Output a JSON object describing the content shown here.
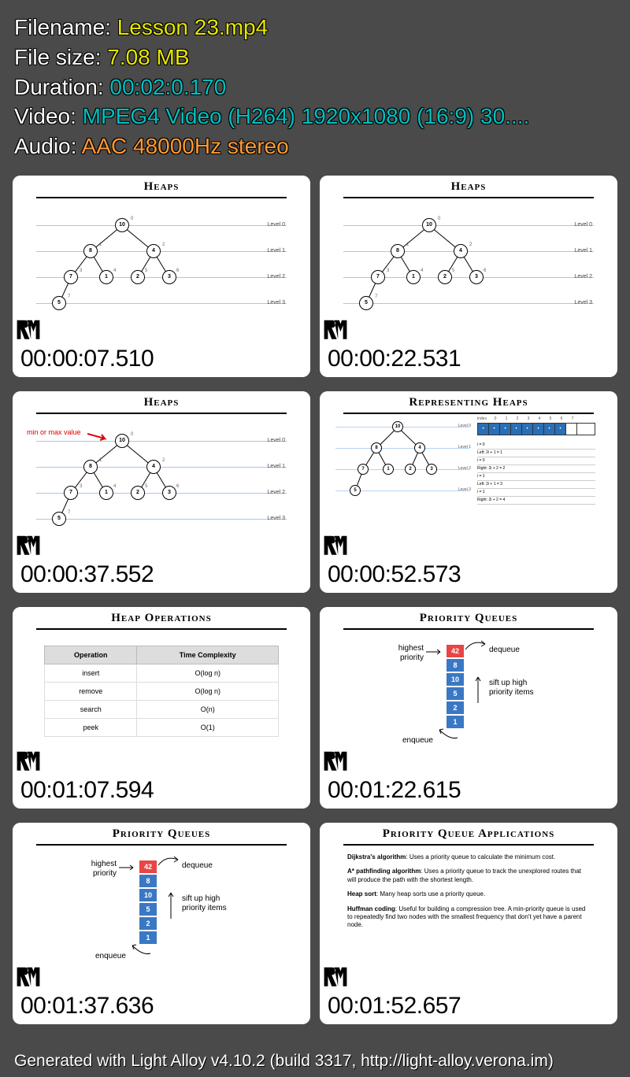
{
  "header": {
    "filename_label": "Filename: ",
    "filename_value": "Lesson 23.mp4",
    "filesize_label": "File size: ",
    "filesize_value": "7.08 MB",
    "duration_label": "Duration: ",
    "duration_value": "00:02:0.170",
    "video_label": "Video: ",
    "video_value": "MPEG4 Video (H264) 1920x1080 (16:9) 30....",
    "audio_label": "Audio: ",
    "audio_value": "AAC 48000Hz stereo"
  },
  "thumbnails": [
    {
      "ts": "00:00:07.510",
      "title": "Heaps",
      "type": "heap_tree"
    },
    {
      "ts": "00:00:22.531",
      "title": "Heaps",
      "type": "heap_tree"
    },
    {
      "ts": "00:00:37.552",
      "title": "Heaps",
      "type": "heap_tree_annot",
      "annot": "min or max value"
    },
    {
      "ts": "00:00:52.573",
      "title": "Representing Heaps",
      "type": "rep_heap"
    },
    {
      "ts": "00:01:07.594",
      "title": "Heap Operations",
      "type": "ops"
    },
    {
      "ts": "00:01:22.615",
      "title": "Priority Queues",
      "type": "pq"
    },
    {
      "ts": "00:01:37.636",
      "title": "Priority Queues",
      "type": "pq"
    },
    {
      "ts": "00:01:52.657",
      "title": "Priority Queue Applications",
      "type": "apps"
    }
  ],
  "heap_tree": {
    "levels": [
      "Level 0",
      "Level 1",
      "Level 2",
      "Level 3"
    ],
    "nodes": [
      "10",
      "8",
      "4",
      "7",
      "1",
      "2",
      "3",
      "5"
    ]
  },
  "ops_table": {
    "headers": [
      "Operation",
      "Time Complexity"
    ],
    "rows": [
      [
        "insert",
        "O(log n)"
      ],
      [
        "remove",
        "O(log n)"
      ],
      [
        "search",
        "O(n)"
      ],
      [
        "peek",
        "O(1)"
      ]
    ]
  },
  "pq": {
    "values": [
      "42",
      "8",
      "10",
      "5",
      "2",
      "1"
    ],
    "highest": "highest priority",
    "dequeue": "dequeue",
    "sift": "sift up high priority items",
    "enqueue": "enqueue"
  },
  "rep": {
    "indices": [
      "0",
      "1",
      "2",
      "3",
      "4",
      "5",
      "6",
      "7"
    ],
    "index_label": "index",
    "formulas": [
      "i = 0",
      "Left: 2i + 1 = 1",
      "i = 0",
      "Right: 2i + 2 = 2",
      "i = 1",
      "Left: 2i + 1 = 3",
      "i = 1",
      "Right: 2i + 2 = 4"
    ]
  },
  "apps": {
    "p1b": "Dijkstra's algorithm",
    "p1t": ": Uses a priority queue to calculate the minimum cost.",
    "p2b": "A* pathfinding algorithm",
    "p2t": ": Uses a priority queue to track the unexplored routes that will produce the path with the shortest length.",
    "p3b": "Heap sort",
    "p3t": ": Many heap sorts use a priority queue.",
    "p4b": "Huffman coding",
    "p4t": ": Useful for building a compression tree. A min-priority queue is used to repeatedly find two nodes with the smallest frequency that don't yet have a parent node."
  },
  "footer": "Generated with Light Alloy v4.10.2 (build 3317, http://light-alloy.verona.im)"
}
